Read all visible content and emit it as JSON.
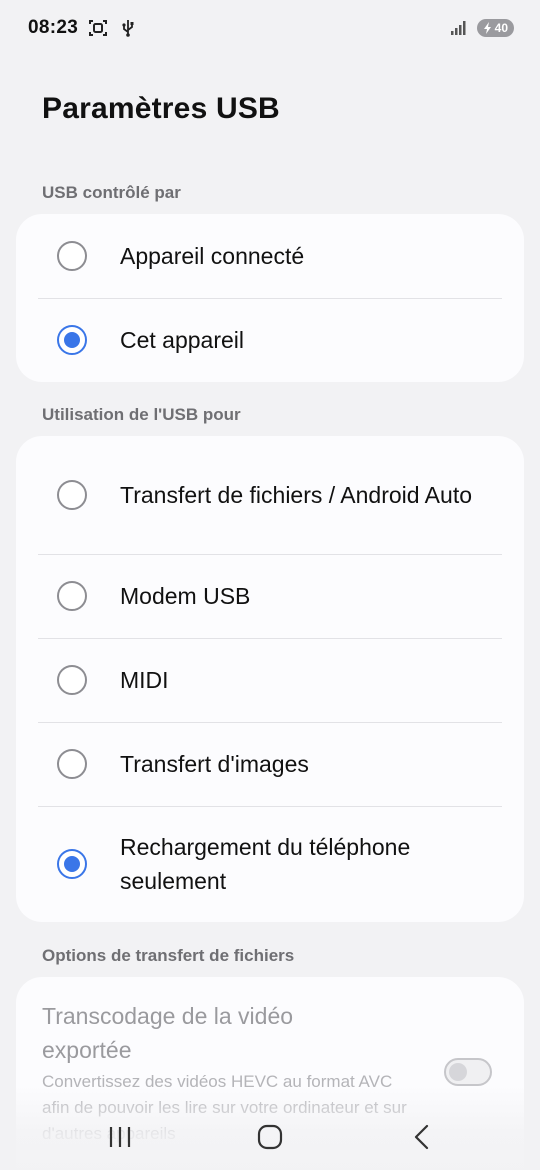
{
  "status_bar": {
    "time": "08:23",
    "battery_level": "40",
    "icons": [
      "screenshot-icon",
      "usb-icon",
      "signal-icon",
      "battery-charging-icon"
    ]
  },
  "page": {
    "title": "Paramètres USB"
  },
  "usb_controlled_by": {
    "label": "USB contrôlé par",
    "options": [
      {
        "label": "Appareil connecté",
        "selected": false
      },
      {
        "label": "Cet appareil",
        "selected": true
      }
    ]
  },
  "usb_usage": {
    "label": "Utilisation de l'USB pour",
    "options": [
      {
        "label": "Transfert de fichiers / Android Auto",
        "selected": false
      },
      {
        "label": "Modem USB",
        "selected": false
      },
      {
        "label": "MIDI",
        "selected": false
      },
      {
        "label": "Transfert d'images",
        "selected": false
      },
      {
        "label": "Rechargement du téléphone seulement",
        "selected": true
      }
    ]
  },
  "file_transfer_options": {
    "label": "Options de transfert de fichiers",
    "transcode": {
      "title": "Transcodage de la vidéo exportée",
      "description": "Convertissez des vidéos HEVC au format AVC afin de pouvoir les lire sur votre ordinateur et sur d'autres appareils",
      "enabled": false
    }
  },
  "nav_bar": {
    "icons": [
      "recent-apps-icon",
      "home-icon",
      "back-icon"
    ]
  },
  "colors": {
    "accent": "#3a76e8",
    "background": "#f2f2f4",
    "card": "#fcfcfe"
  }
}
